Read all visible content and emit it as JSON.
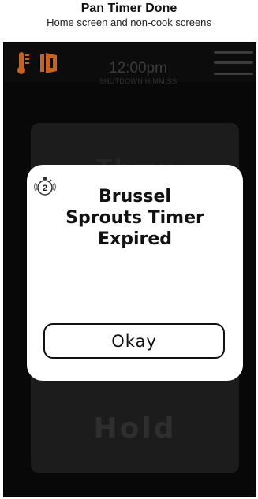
{
  "caption": {
    "title": "Pan Timer Done",
    "subtitle": "Home screen and non-cook screens"
  },
  "status_bar": {
    "time": "12:00pm",
    "shutdown": "SHUTDOWN H:MM:SS",
    "icons": [
      "thermometer-icon",
      "door-icon",
      "menu-icon"
    ],
    "accent_color": "#c7631a"
  },
  "background_panel": {
    "top_label": "Thaw",
    "bottom_label": "Hold"
  },
  "dialog": {
    "timer_number": "2",
    "message_line1": "Brussel",
    "message_line2": "Sprouts Timer",
    "message_line3": "Expired",
    "button_label": "Okay"
  }
}
